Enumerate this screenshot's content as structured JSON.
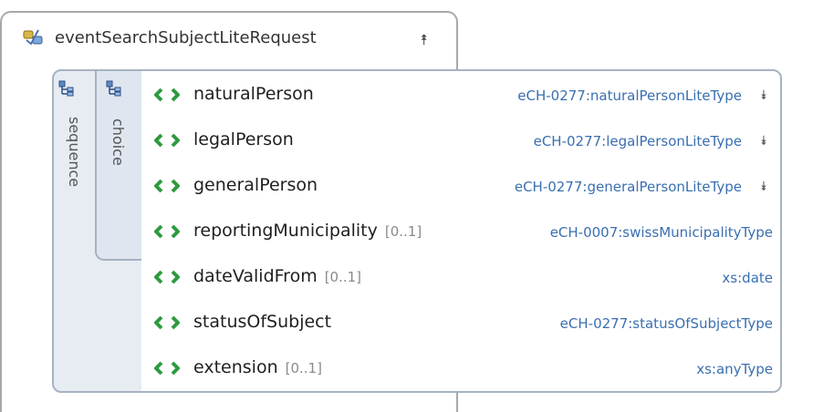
{
  "header": {
    "title": "eventSearchSubjectLiteRequest",
    "title_icon": "complex-type-icon",
    "collapse_icon": "double-chevron-up-icon"
  },
  "compositors": {
    "sequence_label": "sequence",
    "choice_label": "choice"
  },
  "elements": [
    {
      "name": "naturalPerson",
      "cardinality": "",
      "type": "eCH-0277:naturalPersonLiteType",
      "expandable": true
    },
    {
      "name": "legalPerson",
      "cardinality": "",
      "type": "eCH-0277:legalPersonLiteType",
      "expandable": true
    },
    {
      "name": "generalPerson",
      "cardinality": "",
      "type": "eCH-0277:generalPersonLiteType",
      "expandable": true
    },
    {
      "name": "reportingMunicipality",
      "cardinality": "[0..1]",
      "type": "eCH-0007:swissMunicipalityType",
      "expandable": false
    },
    {
      "name": "dateValidFrom",
      "cardinality": "[0..1]",
      "type": "xs:date",
      "expandable": false
    },
    {
      "name": "statusOfSubject",
      "cardinality": "",
      "type": "eCH-0277:statusOfSubjectType",
      "expandable": false
    },
    {
      "name": "extension",
      "cardinality": "[0..1]",
      "type": "xs:anyType",
      "expandable": false
    }
  ],
  "colors": {
    "type_text": "#3a6fb0",
    "element_icon": "#2e9a3e",
    "compositor_bg": "#e7ecf3"
  }
}
